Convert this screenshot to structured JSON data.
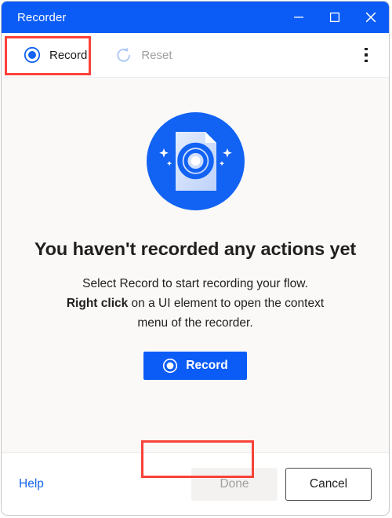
{
  "window": {
    "title": "Recorder",
    "controls": [
      {
        "name": "minimize-button",
        "glyph": "minimize-icon",
        "label": "Minimize"
      },
      {
        "name": "maximize-button",
        "glyph": "maximize-icon",
        "label": "Maximize"
      },
      {
        "name": "close-button",
        "glyph": "close-icon",
        "label": "Close"
      }
    ],
    "title_bar_color": "#0b5cf6"
  },
  "toolbar": {
    "record": {
      "label": "Record",
      "icon": "record-icon",
      "enabled": true
    },
    "reset": {
      "label": "Reset",
      "icon": "reset-icon",
      "enabled": false
    },
    "overflow": {
      "label": "More options",
      "icon": "kebab-menu-icon"
    }
  },
  "annotations": [
    {
      "name": "toolbar-record-highlight",
      "color": "#f9423a"
    },
    {
      "name": "primary-record-highlight",
      "color": "#f9423a"
    }
  ],
  "main": {
    "illustration": {
      "name": "empty-state-recorder-illustration",
      "circle_color": "#1263f4",
      "document_color": "#cfddfb",
      "target_color": "#1263f4"
    },
    "headline": "You haven't recorded any actions yet",
    "body_line_1": "Select Record to start recording your flow.",
    "body_bold": "Right click",
    "body_line_2_rest": " on a UI element to open the context",
    "body_line_3": "menu of the recorder.",
    "record_button": {
      "label": "Record",
      "icon": "record-icon",
      "color": "#0b5cf6"
    }
  },
  "footer": {
    "help_label": "Help",
    "help_color": "#1664e8",
    "done_label": "Done",
    "done_enabled": false,
    "cancel_label": "Cancel"
  }
}
